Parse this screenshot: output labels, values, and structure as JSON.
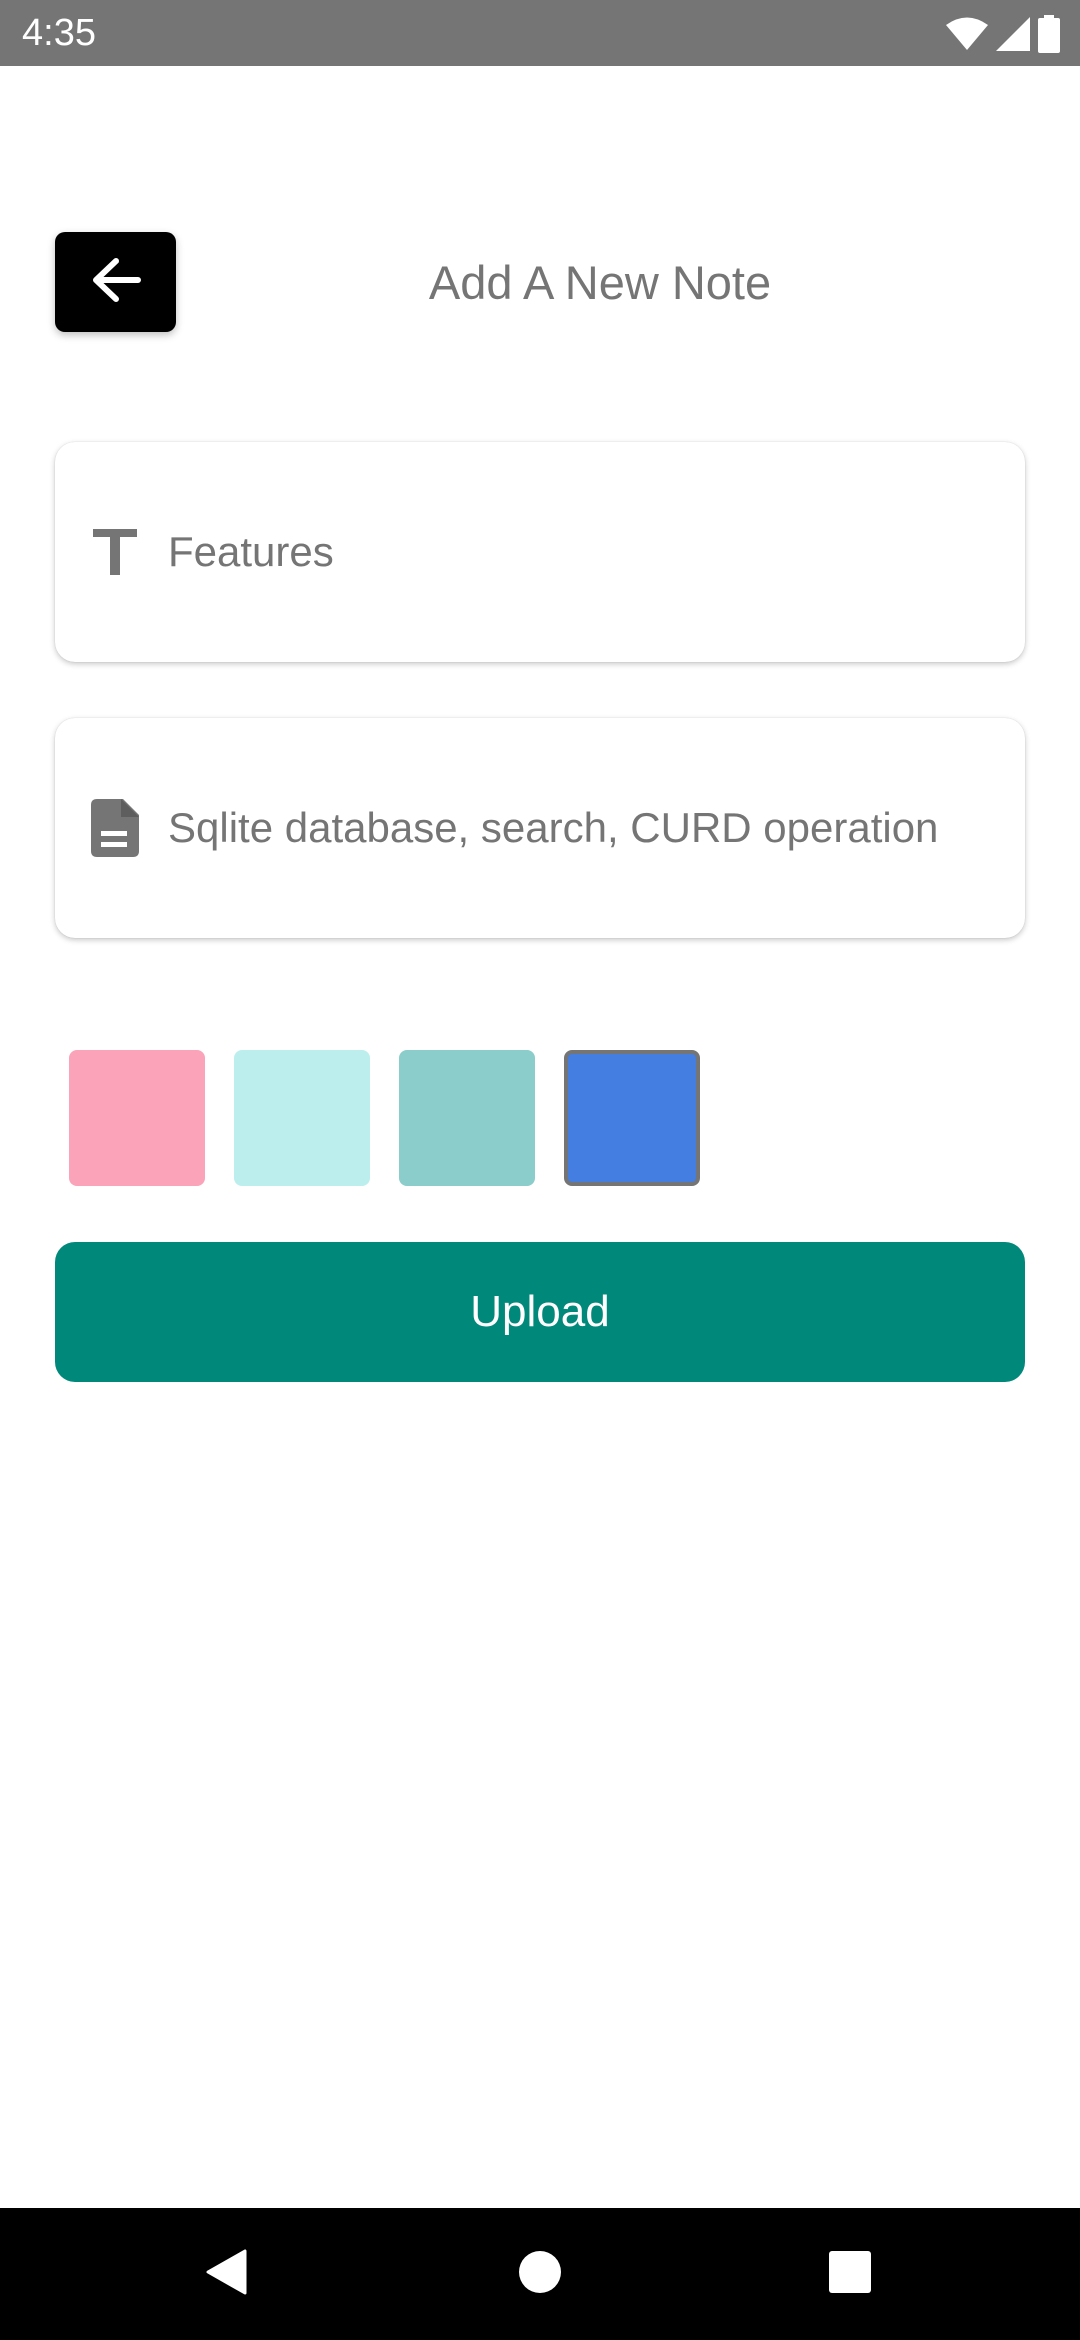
{
  "status_bar": {
    "time": "4:35",
    "icons": [
      "wifi-icon",
      "cell-signal-icon",
      "battery-icon"
    ],
    "background": "#757575"
  },
  "header": {
    "back_icon": "arrow-left-icon",
    "title": "Add A New Note"
  },
  "form": {
    "title_field": {
      "icon": "text-format-icon",
      "value": "Features"
    },
    "description_field": {
      "icon": "document-icon",
      "value": "Sqlite database, search, CURD operation"
    }
  },
  "color_options": [
    {
      "name": "pink",
      "color": "#fba3b8",
      "selected": false
    },
    {
      "name": "light-cyan",
      "color": "#bdeeee",
      "selected": false
    },
    {
      "name": "teal-light",
      "color": "#8acdca",
      "selected": false
    },
    {
      "name": "blue",
      "color": "#437ee0",
      "selected": true
    }
  ],
  "upload_button": {
    "label": "Upload",
    "background": "#00897b"
  },
  "nav_bar": {
    "buttons": [
      "back-triangle-icon",
      "home-circle-icon",
      "recents-square-icon"
    ]
  }
}
